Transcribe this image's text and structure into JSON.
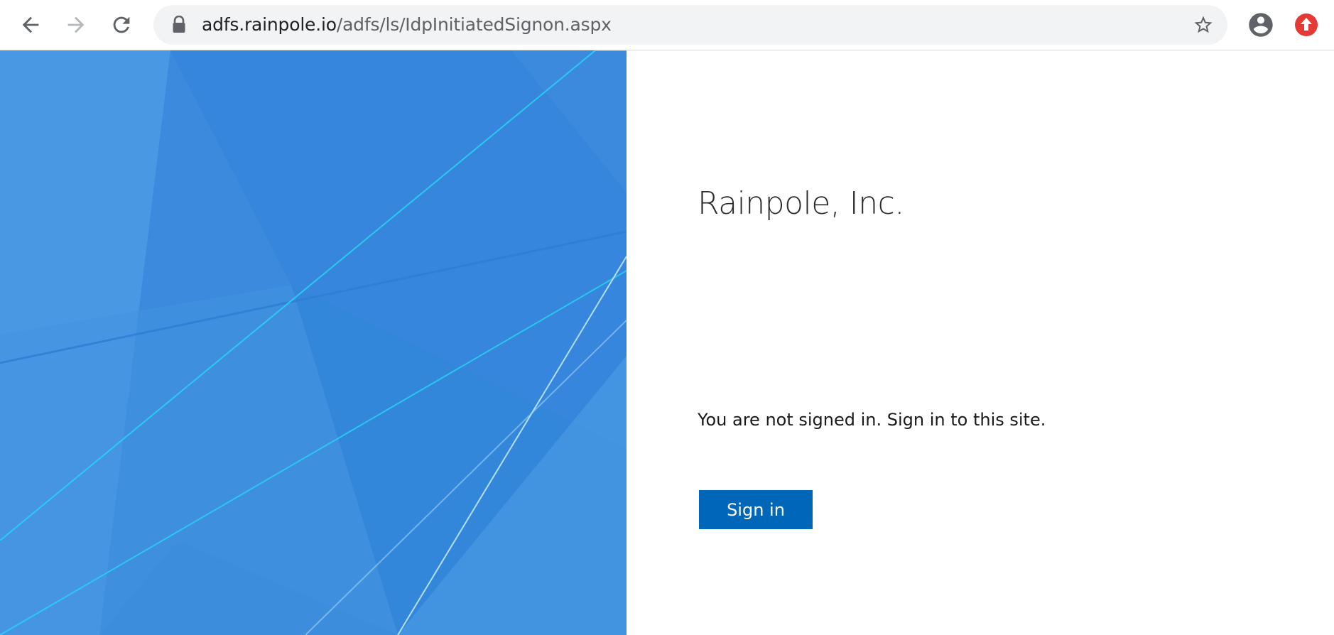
{
  "browser": {
    "url_host": "adfs.rainpole.io",
    "url_path": "/adfs/ls/IdpInitiatedSignon.aspx"
  },
  "colors": {
    "accent": "#0067b8",
    "illustration_base": "#3b8ade",
    "extension_badge": "#e53935"
  },
  "icons": {
    "back": "arrow-left",
    "forward": "arrow-right",
    "reload": "reload",
    "lock": "lock",
    "bookmark": "star-outline",
    "profile": "account-circle",
    "extension": "red-upload-badge"
  },
  "page": {
    "company_name": "Rainpole, Inc.",
    "message": "You are not signed in. Sign in to this site.",
    "signin_label": "Sign in"
  }
}
